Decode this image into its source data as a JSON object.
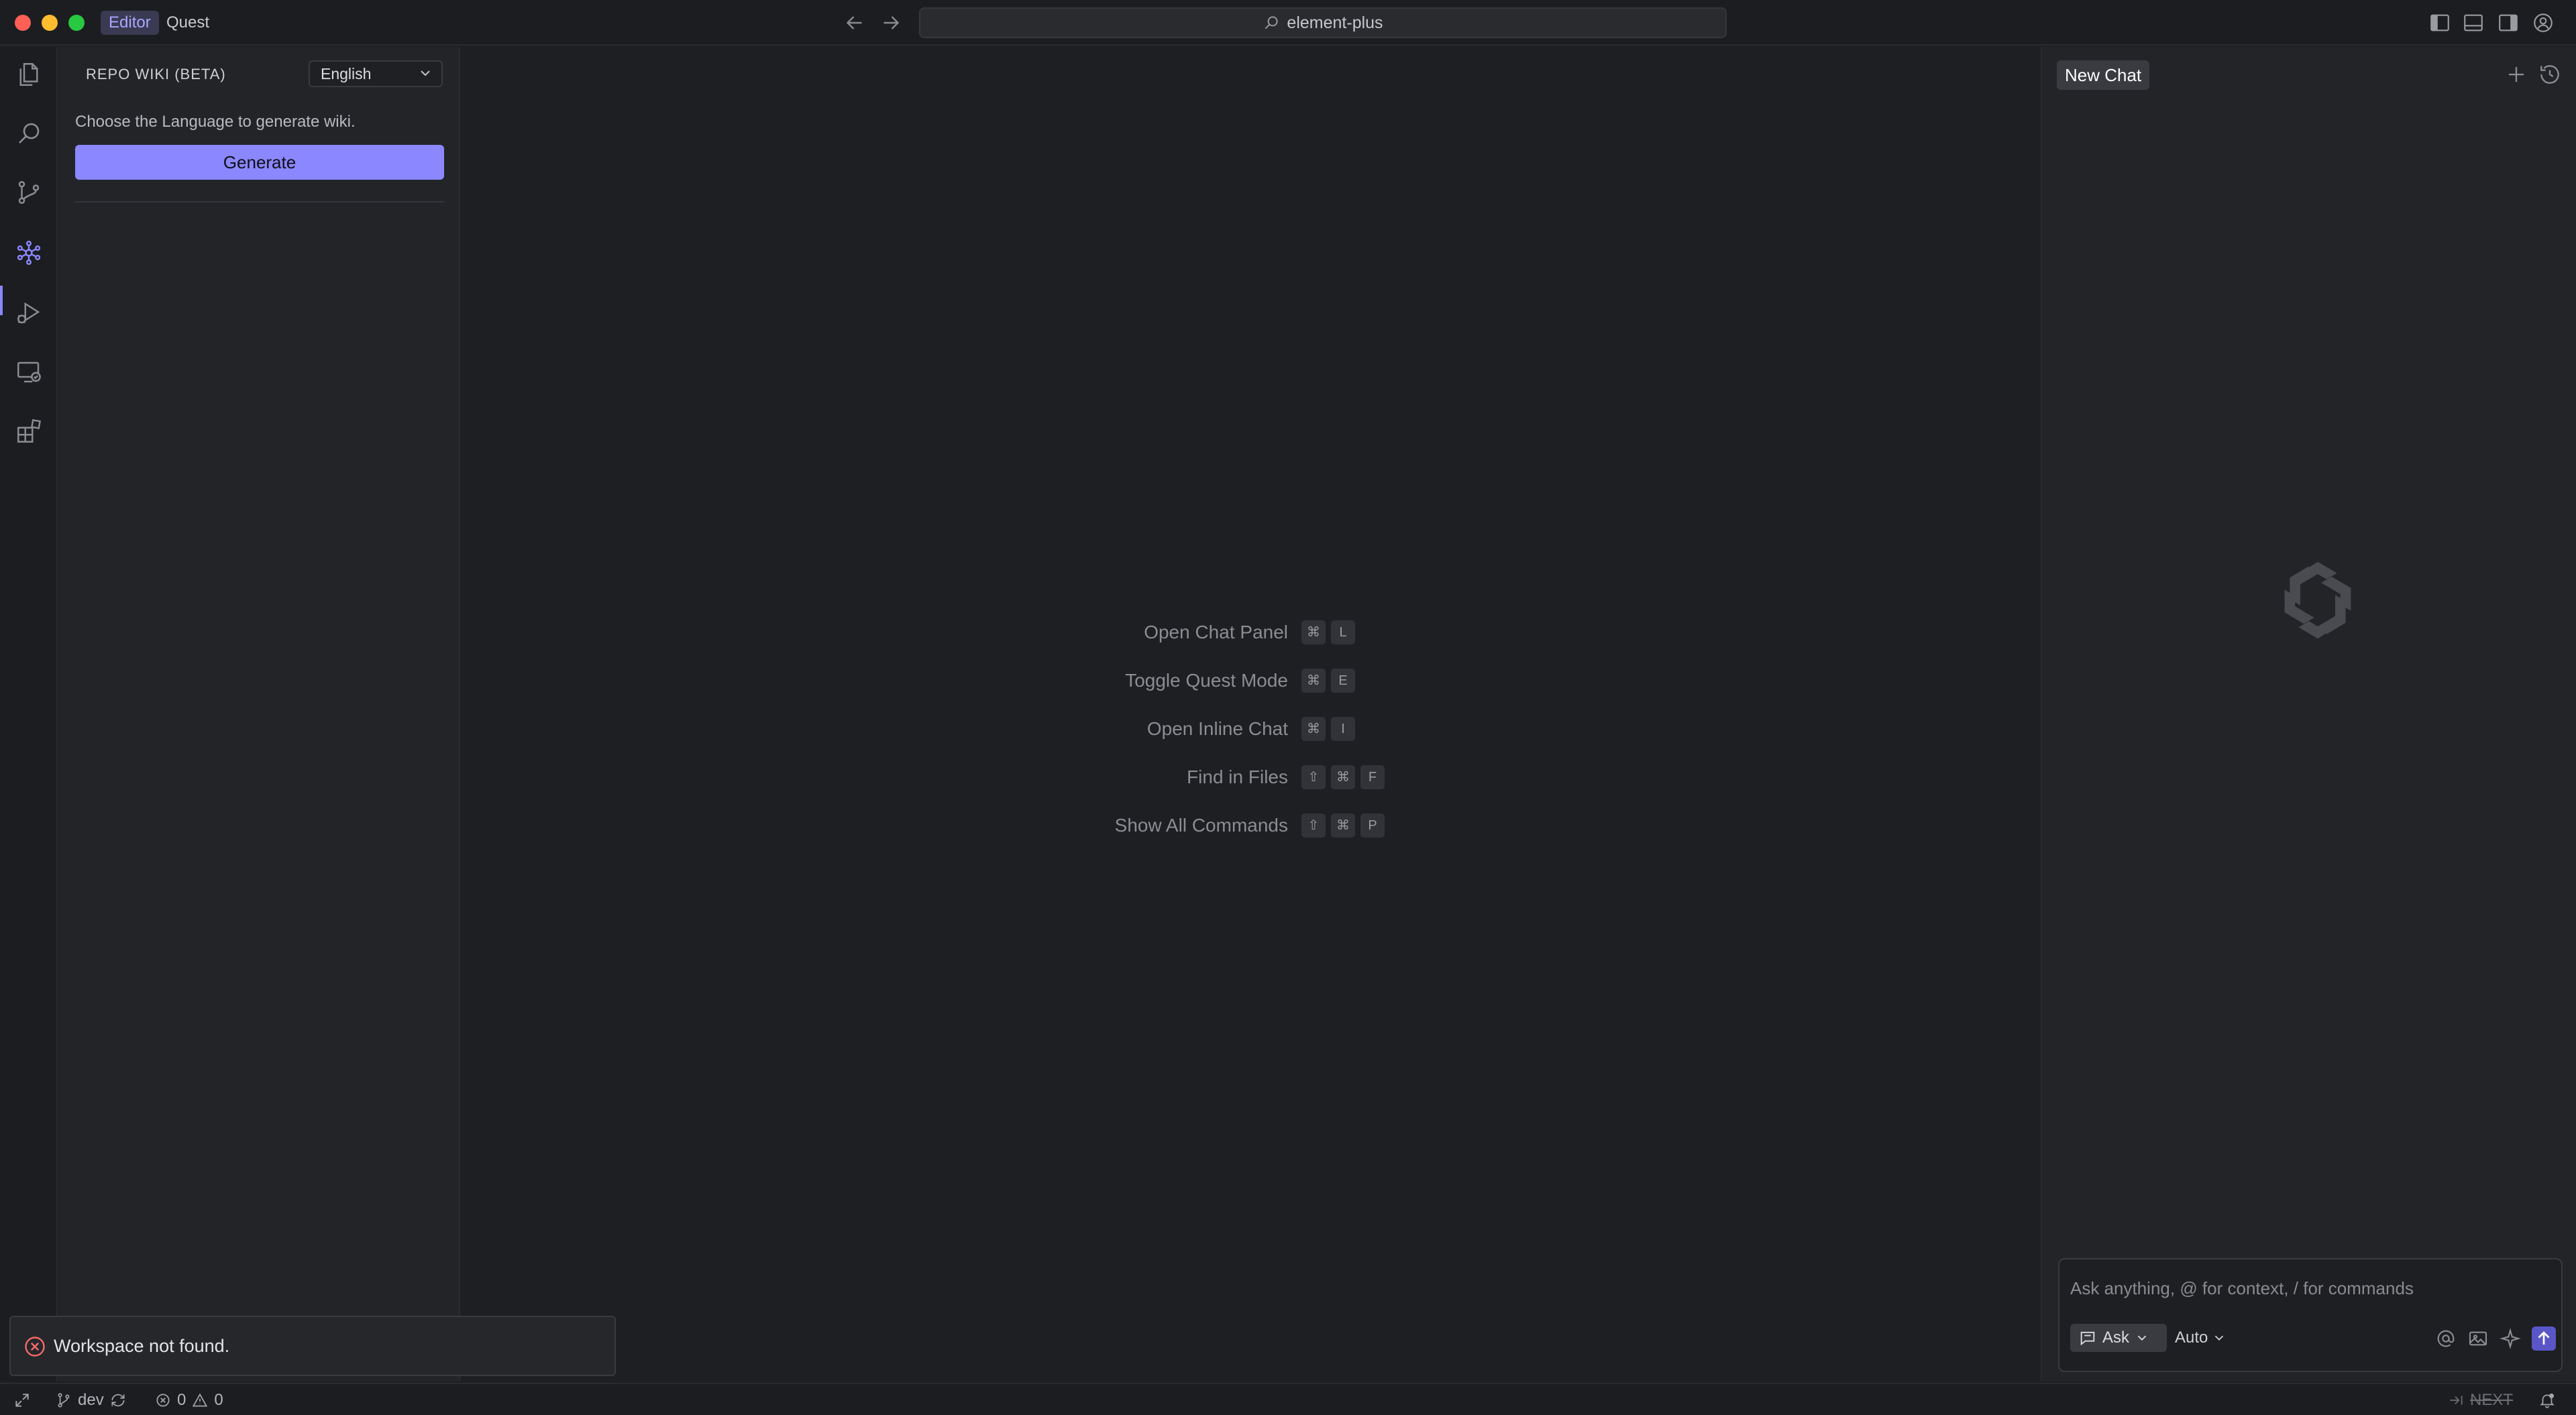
{
  "titlebar": {
    "modes": [
      "Editor",
      "Quest"
    ],
    "search_text": "element-plus",
    "icons": [
      "back-arrow-icon",
      "forward-arrow-icon",
      "toggle-primary-sidebar-icon",
      "toggle-panel-icon",
      "toggle-secondary-sidebar-icon",
      "account-icon"
    ]
  },
  "activity_bar": {
    "items": [
      "explorer",
      "search",
      "source-control",
      "repo-wiki",
      "run-and-debug",
      "remote-explorer",
      "extensions"
    ],
    "active": "repo-wiki"
  },
  "side_panel": {
    "title": "REPO WIKI (BETA)",
    "language": "English",
    "description": "Choose the Language to generate wiki.",
    "generate_label": "Generate"
  },
  "editor": {
    "shortcuts": [
      {
        "label": "Open Chat Panel",
        "keys": [
          "⌘",
          "L"
        ]
      },
      {
        "label": "Toggle Quest Mode",
        "keys": [
          "⌘",
          "E"
        ]
      },
      {
        "label": "Open Inline Chat",
        "keys": [
          "⌘",
          "I"
        ]
      },
      {
        "label": "Find in Files",
        "keys": [
          "⇧",
          "⌘",
          "F"
        ]
      },
      {
        "label": "Show All Commands",
        "keys": [
          "⇧",
          "⌘",
          "P"
        ]
      }
    ]
  },
  "chat": {
    "tab_label": "New Chat",
    "placeholder": "Ask anything, @ for context, / for commands",
    "ask_label": "Ask",
    "model_label": "Auto"
  },
  "toast": {
    "message": "Workspace not found."
  },
  "statusbar": {
    "branch": "dev",
    "errors": "0",
    "warnings": "0",
    "next_label": "NEXT"
  },
  "colors": {
    "accent": "#8b87ff",
    "background": "#1e1f22",
    "panel": "#232428",
    "error": "#f46b6b"
  }
}
